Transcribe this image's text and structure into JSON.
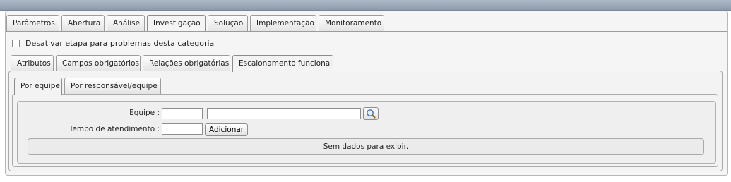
{
  "main_tabs": [
    {
      "label": "Parâmetros"
    },
    {
      "label": "Abertura"
    },
    {
      "label": "Análise"
    },
    {
      "label": "Investigação"
    },
    {
      "label": "Solução"
    },
    {
      "label": "Implementação"
    },
    {
      "label": "Monitoramento"
    }
  ],
  "main_active_tab": "Investigação",
  "disable_stage": {
    "label": "Desativar etapa para problemas desta categoria",
    "checked": false
  },
  "sub_tabs": [
    {
      "label": "Atributos"
    },
    {
      "label": "Campos obrigatórios"
    },
    {
      "label": "Relações obrigatórias"
    },
    {
      "label": "Escalonamento funcional"
    }
  ],
  "sub_active_tab": "Escalonamento funcional",
  "inner_tabs": [
    {
      "label": "Por equipe"
    },
    {
      "label": "Por responsável/equipe"
    }
  ],
  "inner_active_tab": "Por equipe",
  "form": {
    "equipe_label": "Equipe :",
    "equipe_code_value": "",
    "equipe_name_value": "",
    "tempo_label": "Tempo de atendimento :",
    "tempo_value": "",
    "add_button": "Adicionar",
    "search_icon": "magnifier-icon"
  },
  "empty_message": "Sem dados para exibir."
}
